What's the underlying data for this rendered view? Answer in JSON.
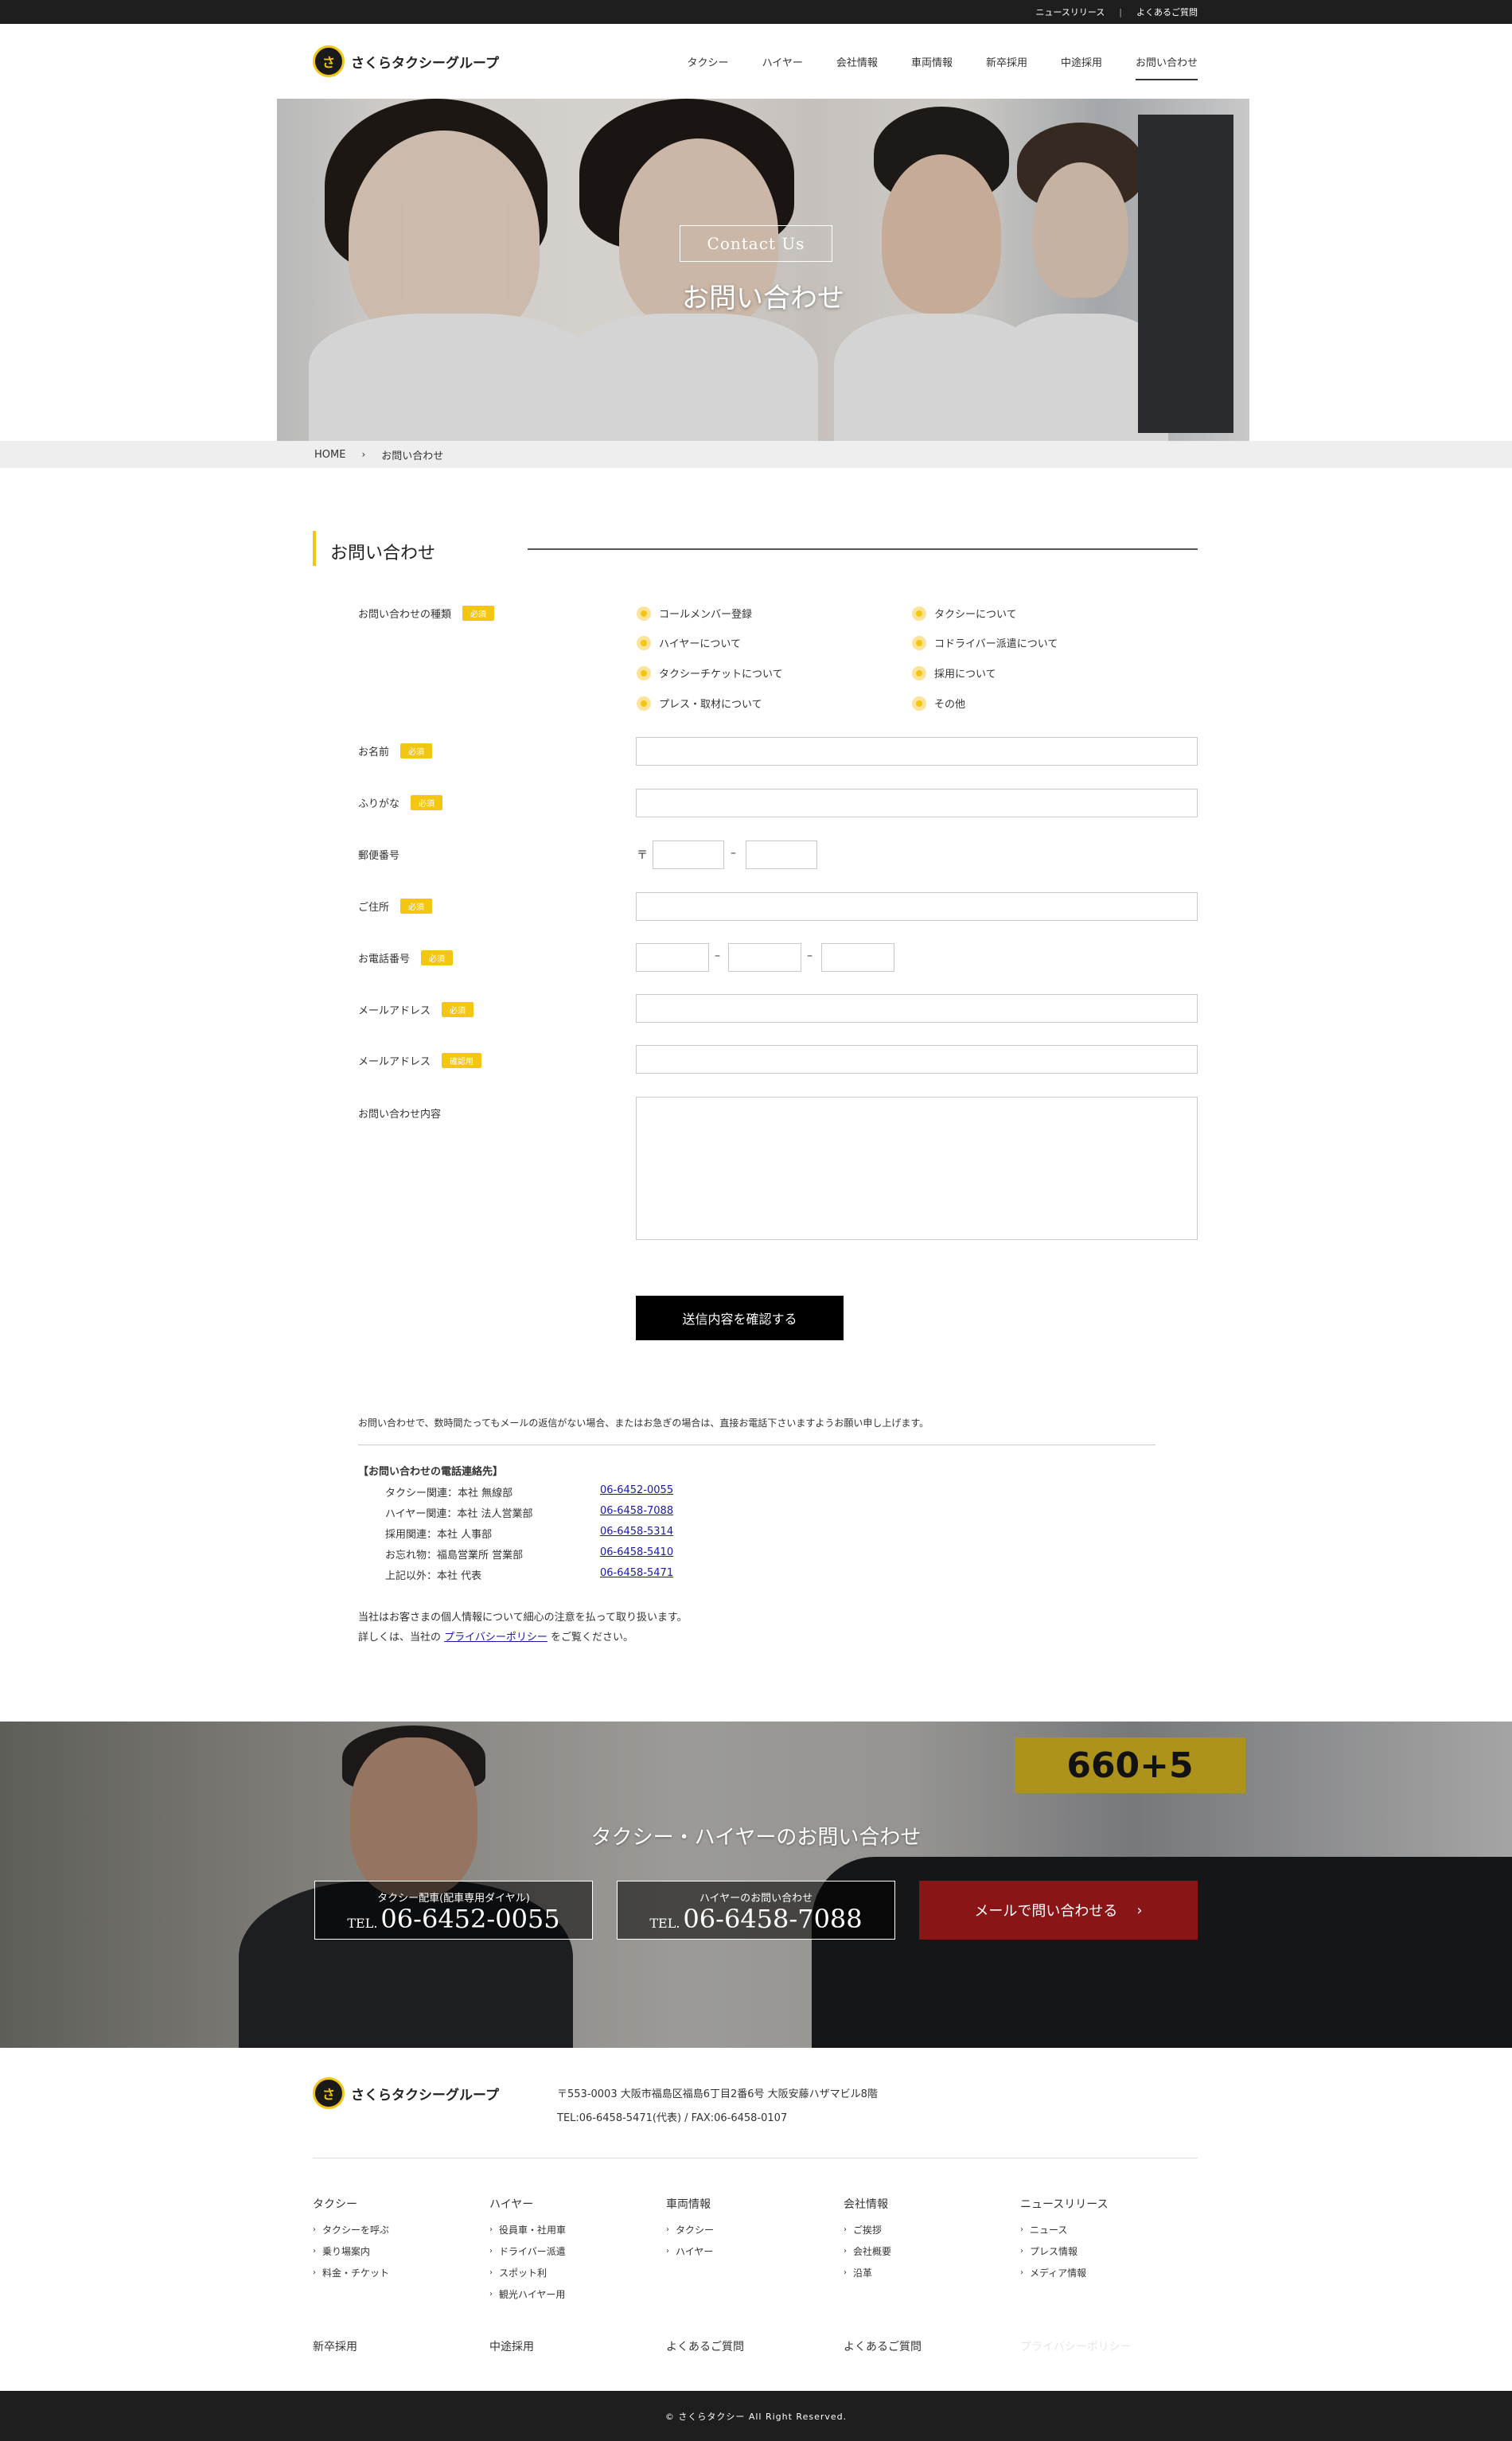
{
  "topbar": {
    "links": [
      "ニュースリリース",
      "よくあるご質問"
    ],
    "separator": "|"
  },
  "header": {
    "logo_mark": "さ",
    "logo_text": "さくらタクシーグループ",
    "nav": [
      "タクシー",
      "ハイヤー",
      "会社情報",
      "車両情報",
      "新卒採用",
      "中途採用",
      "お問い合わせ"
    ]
  },
  "hero": {
    "tag": "Contact Us",
    "title": "お問い合わせ"
  },
  "breadcrumb": {
    "home": "HOME",
    "current": "お問い合わせ"
  },
  "section": {
    "title": "お問い合わせ"
  },
  "form": {
    "required": "必須",
    "optional": "確認用",
    "type_label": "お問い合わせの種類",
    "options_left": [
      "コールメンバー登録",
      "ハイヤーについて",
      "タクシーチケットについて",
      "プレス・取材について"
    ],
    "options_right": [
      "タクシーについて",
      "コドライバー派遣について",
      "採用について",
      "その他"
    ],
    "name_label": "お名前",
    "kana_label": "ふりがな",
    "zip_label": "郵便番号",
    "zip_mark": "〒",
    "dash": "–",
    "address_label": "ご住所",
    "phone_label": "お電話番号",
    "email_label": "メールアドレス",
    "email_confirm_label": "メールアドレス",
    "message_label": "お問い合わせ内容",
    "submit": "送信内容を確認する"
  },
  "info": {
    "notice": "お問い合わせで、数時間たってもメールの返信がない場合、またはお急ぎの場合は、直接お電話下さいますようお願い申し上げます。",
    "contacts_title": "【お問い合わせの電話連絡先】",
    "contacts": [
      {
        "dept": "タクシー関連：本社 無線部",
        "tel": "06-6452-0055"
      },
      {
        "dept": "ハイヤー関連：本社 法人営業部",
        "tel": "06-6458-7088"
      },
      {
        "dept": "採用関連：本社 人事部",
        "tel": "06-6458-5314"
      },
      {
        "dept": "お忘れ物：福島営業所 営業部",
        "tel": "06-6458-5410"
      },
      {
        "dept": "上記以外：本社 代表",
        "tel": "06-6458-5471"
      }
    ],
    "privacy_line1": "当社はお客さまの個人情報について細心の注意を払って取り扱います。",
    "privacy_pre": "詳しくは、当社の",
    "privacy_link": "プライバシーポリシー",
    "privacy_post": "をご覧ください。"
  },
  "banner": {
    "sign": "660+5",
    "title": "タクシー・ハイヤーのお問い合わせ",
    "taxi_label": "タクシー配車(配車専用ダイヤル)",
    "taxi_tel_prefix": "TEL.",
    "taxi_tel": "06-6452-0055",
    "hire_label": "ハイヤーのお問い合わせ",
    "hire_tel_prefix": "TEL.",
    "hire_tel": "06-6458-7088",
    "mail_button": "メールで問い合わせる",
    "mail_arrow": "›"
  },
  "footer": {
    "logo_text": "さくらタクシーグループ",
    "address": "〒553-0003 大阪市福島区福島6丁目2番6号 大阪安藤ハザマビル8階",
    "tel_fax": "TEL:06-6458-5471(代表) / FAX:06-6458-0107",
    "columns": [
      {
        "title": "タクシー",
        "items": [
          "タクシーを呼ぶ",
          "乗り場案内",
          "料金・チケット"
        ]
      },
      {
        "title": "ハイヤー",
        "items": [
          "役員車・社用車",
          "ドライバー派遣",
          "スポット利",
          "観光ハイヤー用"
        ]
      },
      {
        "title": "車両情報",
        "items": [
          "タクシー",
          "ハイヤー"
        ]
      },
      {
        "title": "会社情報",
        "items": [
          "ご挨拶",
          "会社概要",
          "沿革"
        ]
      },
      {
        "title": "ニュースリリース",
        "items": [
          "ニュース",
          "プレス情報",
          "メディア情報"
        ]
      }
    ],
    "bottom_links": [
      "新卒採用",
      "中途採用",
      "よくあるご質問",
      "よくあるご質問",
      "プライバシーポリシー"
    ],
    "copyright": "© さくらタクシー All Right Reserved."
  },
  "colors": {
    "accent": "#f3c613",
    "mail_button": "#8a1516",
    "topbar": "#1e1e1e"
  }
}
